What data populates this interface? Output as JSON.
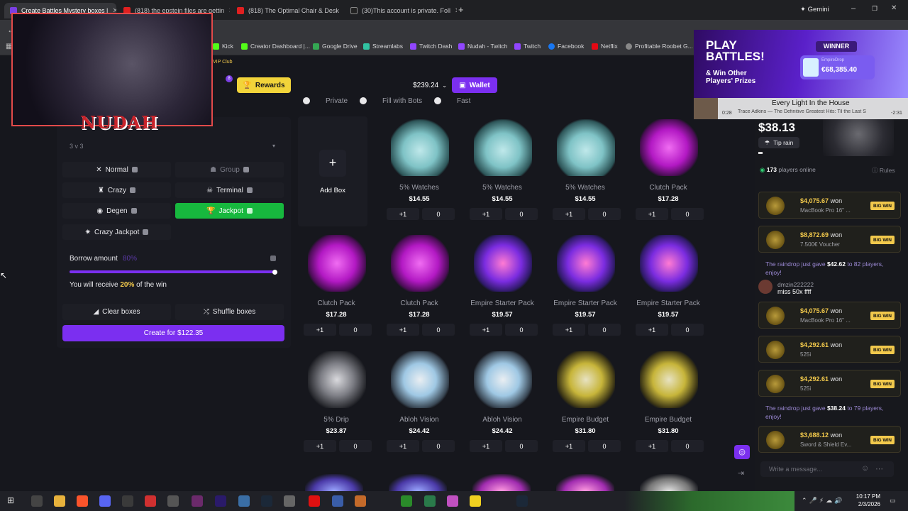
{
  "browser": {
    "tabs": [
      {
        "title": "Create Battles Mystery boxes |",
        "color": "#7b3fe4",
        "active": true
      },
      {
        "title": "(818) the epstein files are gettin",
        "color": "#e02020",
        "active": false
      },
      {
        "title": "(818) The Optimal Chair & Desk",
        "color": "#e02020",
        "active": false
      },
      {
        "title": "(30)This account is private. Foll",
        "color": "#222222",
        "active": false
      }
    ],
    "gemini": "Gemini",
    "bookmarks": [
      {
        "label": "Kick",
        "color": "#53fc18"
      },
      {
        "label": "Creator Dashboard |...",
        "color": "#53fc18"
      },
      {
        "label": "Google Drive",
        "color": "#34a853"
      },
      {
        "label": "Streamlabs",
        "color": "#31c3a2"
      },
      {
        "label": "Twitch Dash",
        "color": "#9146ff"
      },
      {
        "label": "Nudah - Twitch",
        "color": "#9146ff"
      },
      {
        "label": "Twitch",
        "color": "#9146ff"
      },
      {
        "label": "Facebook",
        "color": "#1877f2"
      },
      {
        "label": "Netflix",
        "color": "#e50914"
      },
      {
        "label": "Profitable Roobet G...",
        "color": "#888888"
      }
    ]
  },
  "site": {
    "vip": "VIP Club",
    "badge": "8",
    "rewards": "Rewards",
    "balance": "$239.24",
    "wallet": "Wallet",
    "options": [
      "Private",
      "Fill with Bots",
      "Fast"
    ],
    "battle_size": "3 v 3",
    "modes": [
      {
        "label": "Normal",
        "state": "normal"
      },
      {
        "label": "Group",
        "state": "dim"
      },
      {
        "label": "Crazy",
        "state": "normal"
      },
      {
        "label": "Terminal",
        "state": "normal"
      },
      {
        "label": "Degen",
        "state": "normal"
      },
      {
        "label": "Jackpot",
        "state": "on"
      },
      {
        "label": "Crazy Jackpot",
        "state": "normal"
      }
    ],
    "borrow": {
      "label": "Borrow amount",
      "value_text": "80%",
      "receive_prefix": "You will receive",
      "receive_pct": "20%",
      "receive_suffix": "of the win",
      "fraction": 1.0
    },
    "clear": "Clear boxes",
    "shuffle": "Shuffle boxes",
    "create": "Create for  $122.35",
    "add_box": "Add Box",
    "boxes": [
      {
        "name": "5% Watches",
        "price": "$14.55",
        "kind": "watch",
        "plus": "+1",
        "count": "0"
      },
      {
        "name": "5% Watches",
        "price": "$14.55",
        "kind": "watch",
        "plus": "+1",
        "count": "0"
      },
      {
        "name": "5% Watches",
        "price": "$14.55",
        "kind": "watch",
        "plus": "+1",
        "count": "0"
      },
      {
        "name": "Clutch Pack",
        "price": "$17.28",
        "kind": "clutch",
        "plus": "+1",
        "count": "0"
      },
      {
        "name": "Clutch Pack",
        "price": "$17.28",
        "kind": "clutch",
        "plus": "+1",
        "count": "0"
      },
      {
        "name": "Clutch Pack",
        "price": "$17.28",
        "kind": "clutch",
        "plus": "+1",
        "count": "0"
      },
      {
        "name": "Empire Starter Pack",
        "price": "$19.57",
        "kind": "starter",
        "plus": "+1",
        "count": "0"
      },
      {
        "name": "Empire Starter Pack",
        "price": "$19.57",
        "kind": "starter",
        "plus": "+1",
        "count": "0"
      },
      {
        "name": "Empire Starter Pack",
        "price": "$19.57",
        "kind": "starter",
        "plus": "+1",
        "count": "0"
      },
      {
        "name": "5% Drip",
        "price": "$23.87",
        "kind": "drip",
        "plus": "+1",
        "count": "0"
      },
      {
        "name": "Abloh Vision",
        "price": "$24.42",
        "kind": "abloh",
        "plus": "+1",
        "count": "0"
      },
      {
        "name": "Abloh Vision",
        "price": "$24.42",
        "kind": "abloh",
        "plus": "+1",
        "count": "0"
      },
      {
        "name": "Empire Budget",
        "price": "$31.80",
        "kind": "budget",
        "plus": "+1",
        "count": "0"
      },
      {
        "name": "Empire Budget",
        "price": "$31.80",
        "kind": "budget",
        "plus": "+1",
        "count": "0"
      }
    ]
  },
  "overlay": {
    "streamer": "NUDAH",
    "promo_line1": "PLAY",
    "promo_line2": "BATTLES!",
    "promo_line3": "& Win Other",
    "promo_line4": "Players' Prizes",
    "winner": "WINNER",
    "winner_site": "EmpireDrop",
    "winner_amount": "€68,385.40",
    "song_title": "Every Light In the House",
    "song_artist": "Trace Adkins — The Definitive Greatest Hits: Til the Last S",
    "song_elapsed": "0:28",
    "song_remaining": "-2:31"
  },
  "chat": {
    "pot": "$38.13",
    "tip_rain": "Tip rain",
    "online_count": "173",
    "online_label": "players online",
    "rules": "Rules",
    "feed": [
      {
        "amount": "$4,075.67",
        "won": "won",
        "item": "MacBook Pro 16\" ...",
        "big": "BIG WIN"
      },
      {
        "amount": "$8,872.69",
        "won": "won",
        "item": "7.500€ Voucher",
        "big": "BIG WIN"
      },
      {
        "amount": "$4,075.67",
        "won": "won",
        "item": "MacBook Pro 16\" ...",
        "big": "BIG WIN"
      },
      {
        "amount": "$4,292.61",
        "won": "won",
        "item": "525i",
        "big": "BIG WIN"
      },
      {
        "amount": "$4,292.61",
        "won": "won",
        "item": "525i",
        "big": "BIG WIN"
      },
      {
        "amount": "$3,688.12",
        "won": "won",
        "item": "Sword & Shield Ev...",
        "big": "BIG WIN"
      }
    ],
    "rain1_prefix": "The raindrop just gave",
    "rain1_amount": "$42.62",
    "rain1_suffix": "to 82 players, enjoy!",
    "rain2_prefix": "The raindrop just gave",
    "rain2_amount": "$38.24",
    "rain2_suffix": "to 79 players, enjoy!",
    "msg_user": "dmzin222222",
    "msg_text": "miss 50x ffff",
    "input_placeholder": "Write a message..."
  },
  "taskbar": {
    "time": "10:17 PM",
    "date": "2/3/2026"
  }
}
